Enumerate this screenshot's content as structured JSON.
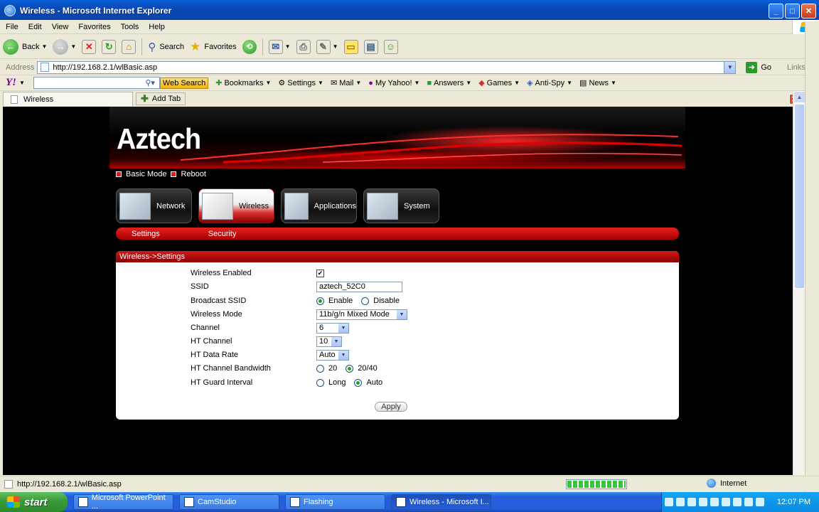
{
  "window": {
    "title": "Wireless - Microsoft Internet Explorer",
    "min": "_",
    "max": "□",
    "close": "✕"
  },
  "menu": [
    "File",
    "Edit",
    "View",
    "Favorites",
    "Tools",
    "Help"
  ],
  "toolbar": {
    "back": "Back",
    "search": "Search",
    "favorites": "Favorites"
  },
  "address": {
    "label": "Address",
    "url": "http://192.168.2.1/wlBasic.asp",
    "go": "Go",
    "links": "Links"
  },
  "yahoo": {
    "logo": "Y!",
    "web_search": "Web Search",
    "bookmarks": "Bookmarks",
    "settings": "Settings",
    "mail": "Mail",
    "my_yahoo": "My Yahoo!",
    "answers": "Answers",
    "games": "Games",
    "anti_spy": "Anti-Spy",
    "news": "News"
  },
  "tabs": {
    "active": "Wireless",
    "add": "Add Tab"
  },
  "router": {
    "brand": "Aztech",
    "modes": [
      "Basic Mode",
      "Reboot"
    ],
    "nav": [
      "Network",
      "Wireless",
      "Applications",
      "System"
    ],
    "subnav": [
      "Settings",
      "Security"
    ],
    "panel_title": "Wireless->Settings",
    "fields": {
      "wireless_enabled": "Wireless Enabled",
      "ssid": "SSID",
      "ssid_value": "aztech_52C0",
      "broadcast_ssid": "Broadcast SSID",
      "enable": "Enable",
      "disable": "Disable",
      "wireless_mode": "Wireless Mode",
      "wireless_mode_value": "11b/g/n Mixed Mode",
      "channel": "Channel",
      "channel_value": "6",
      "ht_channel": "HT Channel",
      "ht_channel_value": "10",
      "ht_data_rate": "HT Data Rate",
      "ht_data_rate_value": "Auto",
      "ht_channel_bandwidth": "HT Channel Bandwidth",
      "bw_20": "20",
      "bw_2040": "20/40",
      "ht_guard_interval": "HT Guard Interval",
      "guard_long": "Long",
      "guard_auto": "Auto"
    },
    "apply": "Apply"
  },
  "status": {
    "url": "http://192.168.2.1/wlBasic.asp",
    "zone": "Internet",
    "progress": 1.0
  },
  "taskbar": {
    "start": "start",
    "tasks": [
      "Microsoft PowerPoint ...",
      "CamStudio",
      "Flashing",
      "Wireless - Microsoft I..."
    ],
    "clock": "12:07 PM"
  }
}
